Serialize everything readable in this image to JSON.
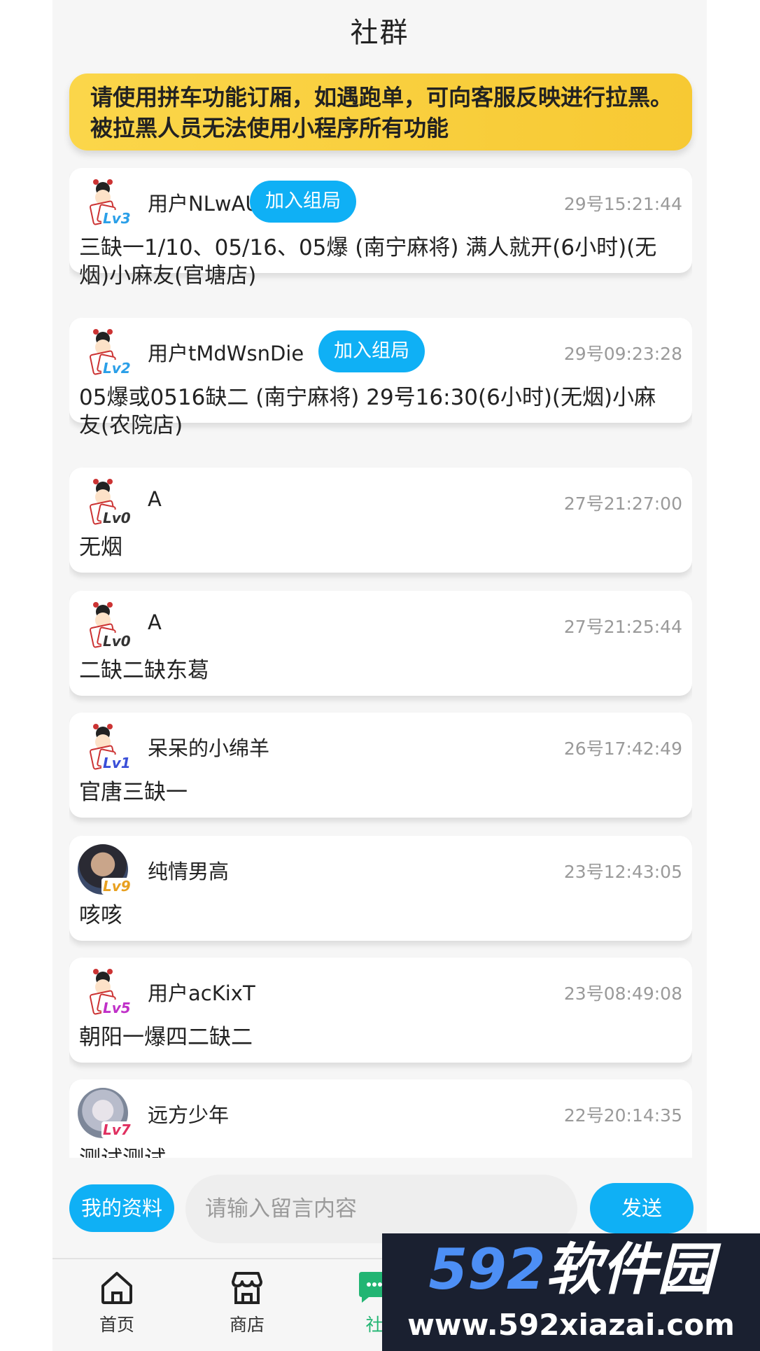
{
  "header": {
    "title": "社群"
  },
  "notice": {
    "text": "请使用拼车功能订厢，如遇跑单，可向客服反映进行拉黑。被拉黑人员无法使用小程序所有功能"
  },
  "posts": [
    {
      "user": "用户NLwAUo",
      "level": "Lv3",
      "level_color": "#2a9fe8",
      "join_label": "加入组局",
      "time": "29号15:21:44",
      "content": "三缺一1/10、05/16、05爆 (南宁麻将) 满人就开(6小时)(无烟)小麻友(官塘店)"
    },
    {
      "user": "用户tMdWsnDie",
      "level": "Lv2",
      "level_color": "#2a9fe8",
      "join_label": "加入组局",
      "time": "29号09:23:28",
      "content": "05爆或0516缺二 (南宁麻将) 29号16:30(6小时)(无烟)小麻友(农院店)"
    },
    {
      "user": "A",
      "level": "Lv0",
      "level_color": "#333333",
      "time": "27号21:27:00",
      "content": "无烟"
    },
    {
      "user": "A",
      "level": "Lv0",
      "level_color": "#333333",
      "time": "27号21:25:44",
      "content": "二缺二缺东葛"
    },
    {
      "user": "呆呆的小绵羊",
      "level": "Lv1",
      "level_color": "#3a4fd8",
      "time": "26号17:42:49",
      "content": "官唐三缺一"
    },
    {
      "user": "纯情男高",
      "level": "Lv9",
      "level_color": "#e8a020",
      "time": "23号12:43:05",
      "content": "咳咳"
    },
    {
      "user": "用户acKixT",
      "level": "Lv5",
      "level_color": "#c030c8",
      "time": "23号08:49:08",
      "content": "朝阳一爆四二缺二"
    },
    {
      "user": "远方少年",
      "level": "Lv7",
      "level_color": "#e03060",
      "time": "22号20:14:35",
      "content": "测试测试"
    }
  ],
  "composer": {
    "profile_label": "我的资料",
    "placeholder": "请输入留言内容",
    "send_label": "发送"
  },
  "tabbar": {
    "home": "首页",
    "shop": "商店",
    "community": "社"
  },
  "watermark": {
    "brand_num": "592",
    "brand_cn": "软件园",
    "url": "www.592xiazai.com"
  },
  "colors": {
    "accent": "#0fb0f5",
    "notice_bg": "#f8cf3c",
    "active_tab": "#22b573"
  }
}
